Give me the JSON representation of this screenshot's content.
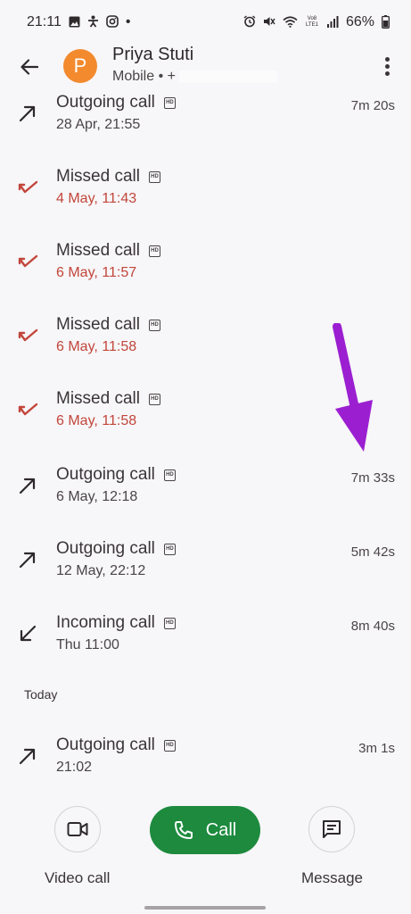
{
  "status": {
    "time": "21:11",
    "left_icons": [
      "gallery-icon",
      "accessibility-icon",
      "instagram-icon"
    ],
    "dot": "•",
    "right_icons": [
      "alarm-icon",
      "mute-icon",
      "wifi-icon",
      "volte-icon",
      "signal-icon"
    ],
    "volte": "Vo8 LTE1",
    "battery": "66%"
  },
  "header": {
    "avatar_letter": "P",
    "contact_name": "Priya Stuti",
    "contact_sub": "Mobile • +"
  },
  "calls": [
    {
      "type": "Outgoing call",
      "time": "28 Apr, 21:55",
      "duration": "7m 20s",
      "kind": "outgoing"
    },
    {
      "type": "Missed call",
      "time": "4 May, 11:43",
      "duration": "",
      "kind": "missed"
    },
    {
      "type": "Missed call",
      "time": "6 May, 11:57",
      "duration": "",
      "kind": "missed"
    },
    {
      "type": "Missed call",
      "time": "6 May, 11:58",
      "duration": "",
      "kind": "missed"
    },
    {
      "type": "Missed call",
      "time": "6 May, 11:58",
      "duration": "",
      "kind": "missed"
    },
    {
      "type": "Outgoing call",
      "time": "6 May, 12:18",
      "duration": "7m 33s",
      "kind": "outgoing"
    },
    {
      "type": "Outgoing call",
      "time": "12 May, 22:12",
      "duration": "5m 42s",
      "kind": "outgoing"
    },
    {
      "type": "Incoming call",
      "time": "Thu 11:00",
      "duration": "8m 40s",
      "kind": "incoming"
    }
  ],
  "today_label": "Today",
  "today_call": {
    "type": "Outgoing call",
    "time": "21:02",
    "duration": "3m 1s",
    "kind": "outgoing"
  },
  "hd_label": "HD",
  "actions": {
    "video_call": "Video call",
    "call": "Call",
    "message": "Message"
  },
  "colors": {
    "missed": "#c2463b",
    "call_button": "#1d8a3e",
    "avatar": "#f38a2e",
    "annotation_arrow": "#9b1fd1"
  }
}
